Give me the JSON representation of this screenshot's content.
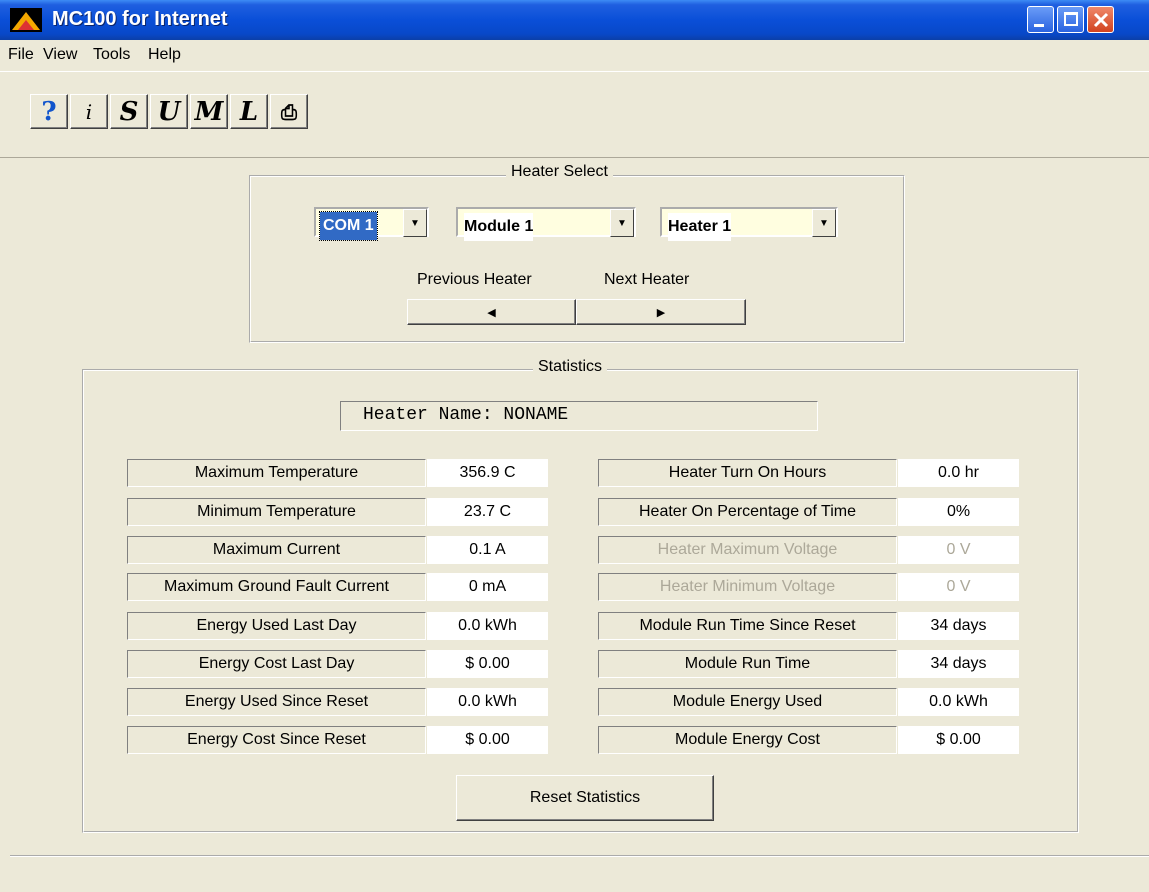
{
  "window": {
    "title": "MC100 for Internet"
  },
  "menu": [
    "File",
    "View",
    "Tools",
    "Help"
  ],
  "toolbar": {
    "buttons": [
      {
        "name": "help-icon",
        "glyph": "?"
      },
      {
        "name": "info-icon",
        "glyph": "i"
      },
      {
        "name": "s-icon",
        "glyph": "S"
      },
      {
        "name": "u-icon",
        "glyph": "U"
      },
      {
        "name": "m-icon",
        "glyph": "M"
      },
      {
        "name": "l-icon",
        "glyph": "L"
      },
      {
        "name": "export-icon",
        "glyph": "⎙"
      }
    ]
  },
  "heater_select": {
    "title": "Heater Select",
    "com": "COM 1",
    "module": "Module 1",
    "heater": "Heater 1",
    "prev_label": "Previous Heater",
    "next_label": "Next Heater"
  },
  "statistics": {
    "title": "Statistics",
    "heater_name": "Heater Name: NONAME",
    "left": [
      {
        "label": "Maximum Temperature",
        "value": "356.9 C"
      },
      {
        "label": "Minimum Temperature",
        "value": "23.7 C"
      },
      {
        "label": "Maximum Current",
        "value": "0.1 A"
      },
      {
        "label": "Maximum Ground Fault Current",
        "value": "0 mA"
      },
      {
        "label": "Energy Used Last Day",
        "value": "0.0 kWh"
      },
      {
        "label": "Energy Cost Last Day",
        "value": "$ 0.00"
      },
      {
        "label": "Energy Used Since Reset",
        "value": "0.0 kWh"
      },
      {
        "label": "Energy Cost Since Reset",
        "value": "$ 0.00"
      }
    ],
    "right": [
      {
        "label": "Heater Turn On Hours",
        "value": "0.0 hr"
      },
      {
        "label": "Heater On Percentage of Time",
        "value": "0%"
      },
      {
        "label": "Heater Maximum Voltage",
        "value": "0 V",
        "disabled": true
      },
      {
        "label": "Heater Minimum Voltage",
        "value": "0 V",
        "disabled": true
      },
      {
        "label": "Module Run Time Since Reset",
        "value": "34 days"
      },
      {
        "label": "Module Run Time",
        "value": "34 days"
      },
      {
        "label": "Module Energy Used",
        "value": "0.0 kWh"
      },
      {
        "label": "Module Energy Cost",
        "value": "$ 0.00"
      }
    ],
    "reset_label": "Reset Statistics"
  }
}
